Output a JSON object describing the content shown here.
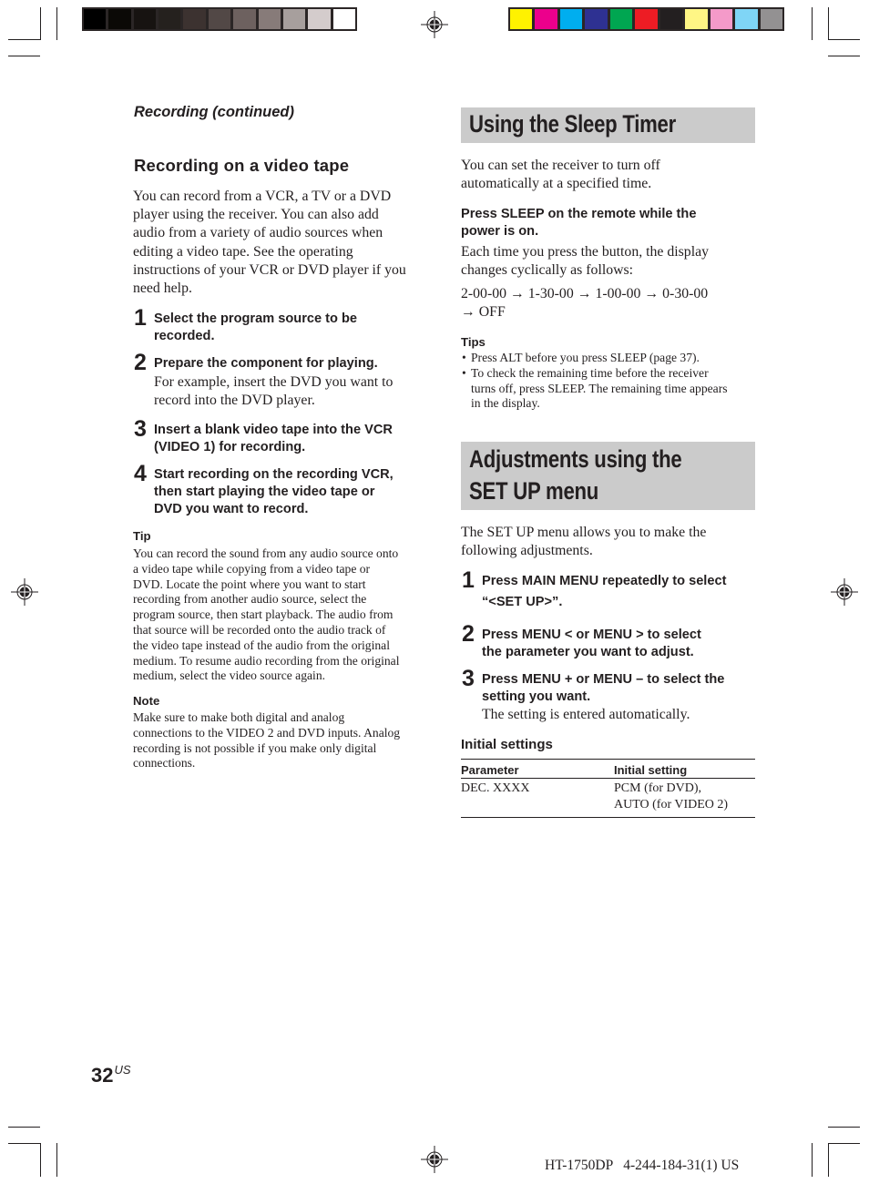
{
  "print_marks": {
    "grayscale_swatches": [
      "#000000",
      "#0b0906",
      "#171311",
      "#25211e",
      "#3c3230",
      "#524846",
      "#6d615f",
      "#877b79",
      "#a79f9d",
      "#d4cccc",
      "#ffffff"
    ],
    "color_swatches": [
      "#fff200",
      "#ec008c",
      "#00aeef",
      "#2e3192",
      "#00a651",
      "#ed1c24",
      "#231f20",
      "#fff685",
      "#f49ac9",
      "#7fd5f6",
      "#939192"
    ]
  },
  "left_column": {
    "running_head": "Recording (continued)",
    "section_title": "Recording on a video tape",
    "intro": "You can record from a VCR, a TV or a DVD player using the receiver. You can also add audio from a variety of audio sources when editing a video tape. See the operating instructions of your VCR or DVD player if you need help.",
    "intro_lines": [
      "You can record from a VCR, a TV or a DVD",
      "player using the receiver. You can also add",
      "audio from a variety of audio sources when",
      "editing a video tape. See the operating",
      "instructions of your VCR or DVD player if you",
      "need help."
    ],
    "steps": [
      {
        "num": "1",
        "title_lines": [
          "Select the program source to be",
          "recorded."
        ],
        "detail_lines": []
      },
      {
        "num": "2",
        "title_lines": [
          "Prepare the component for playing."
        ],
        "detail_lines": [
          "For example, insert the DVD you want to",
          "record into the DVD player."
        ]
      },
      {
        "num": "3",
        "title_lines": [
          "Insert a blank video tape into the VCR",
          "(VIDEO 1) for recording."
        ],
        "detail_lines": []
      },
      {
        "num": "4",
        "title_lines": [
          "Start recording on the recording VCR,",
          "then start playing the video tape or",
          "DVD you want to record."
        ],
        "detail_lines": []
      }
    ],
    "tip_label": "Tip",
    "tip_lines": [
      "You can record the sound from any audio source onto",
      "a video tape while copying from a video tape or",
      "DVD. Locate the point where you want to start",
      "recording from another audio source, select the",
      "program source, then start playback. The audio from",
      "that source will be recorded onto the audio track of",
      "the video tape instead of the audio from the original",
      "medium. To resume audio recording from the original",
      "medium, select the video source again."
    ],
    "note_label": "Note",
    "note_lines": [
      "Make sure to make both digital and analog",
      "connections to the VIDEO 2 and DVD inputs. Analog",
      "recording is not possible if you make only digital",
      "connections."
    ]
  },
  "right_column": {
    "sleep_section": {
      "title": "Using the Sleep Timer",
      "intro_lines": [
        "You can set the receiver to turn off",
        "automatically at a specified time."
      ],
      "instruction_lines": [
        "Press SLEEP on the remote while the",
        "power is on."
      ],
      "detail_lines": [
        "Each time you press the button, the display",
        "changes cyclically as follows:"
      ],
      "cycle": [
        "2-00-00",
        "1-30-00",
        "1-00-00",
        "0-30-00",
        "OFF"
      ],
      "arrow": "→",
      "tips_label": "Tips",
      "tips": [
        [
          "Press ALT before you press SLEEP (page 37)."
        ],
        [
          "To check the remaining time before the receiver",
          "turns off, press SLEEP. The remaining time appears",
          "in the display."
        ]
      ]
    },
    "setup_section": {
      "title_lines": [
        "Adjustments using the",
        "SET UP menu"
      ],
      "intro_lines": [
        "The SET UP menu allows you to make the",
        "following adjustments."
      ],
      "steps": [
        {
          "num": "1",
          "title_lines": [
            "Press MAIN MENU repeatedly to select",
            "“<SET UP>”."
          ],
          "detail_lines": []
        },
        {
          "num": "2",
          "title_lines": [
            "Press MENU < or MENU > to select",
            "the parameter you want to adjust."
          ],
          "detail_lines": []
        },
        {
          "num": "3",
          "title_lines": [
            "Press MENU + or MENU – to select the",
            "setting you want."
          ],
          "detail_lines": [
            "The setting is entered automatically."
          ]
        }
      ],
      "initial_settings_label": "Initial settings",
      "table": {
        "headers": [
          "Parameter",
          "Initial setting"
        ],
        "rows": [
          {
            "parameter": "DEC. XXXX",
            "setting_lines": [
              "PCM (for DVD),",
              "AUTO (for VIDEO 2)"
            ]
          }
        ]
      }
    }
  },
  "footer": {
    "page_number": "32",
    "page_suffix": "US",
    "model_code": "HT-1750DP   4-244-184-31(1) US"
  }
}
